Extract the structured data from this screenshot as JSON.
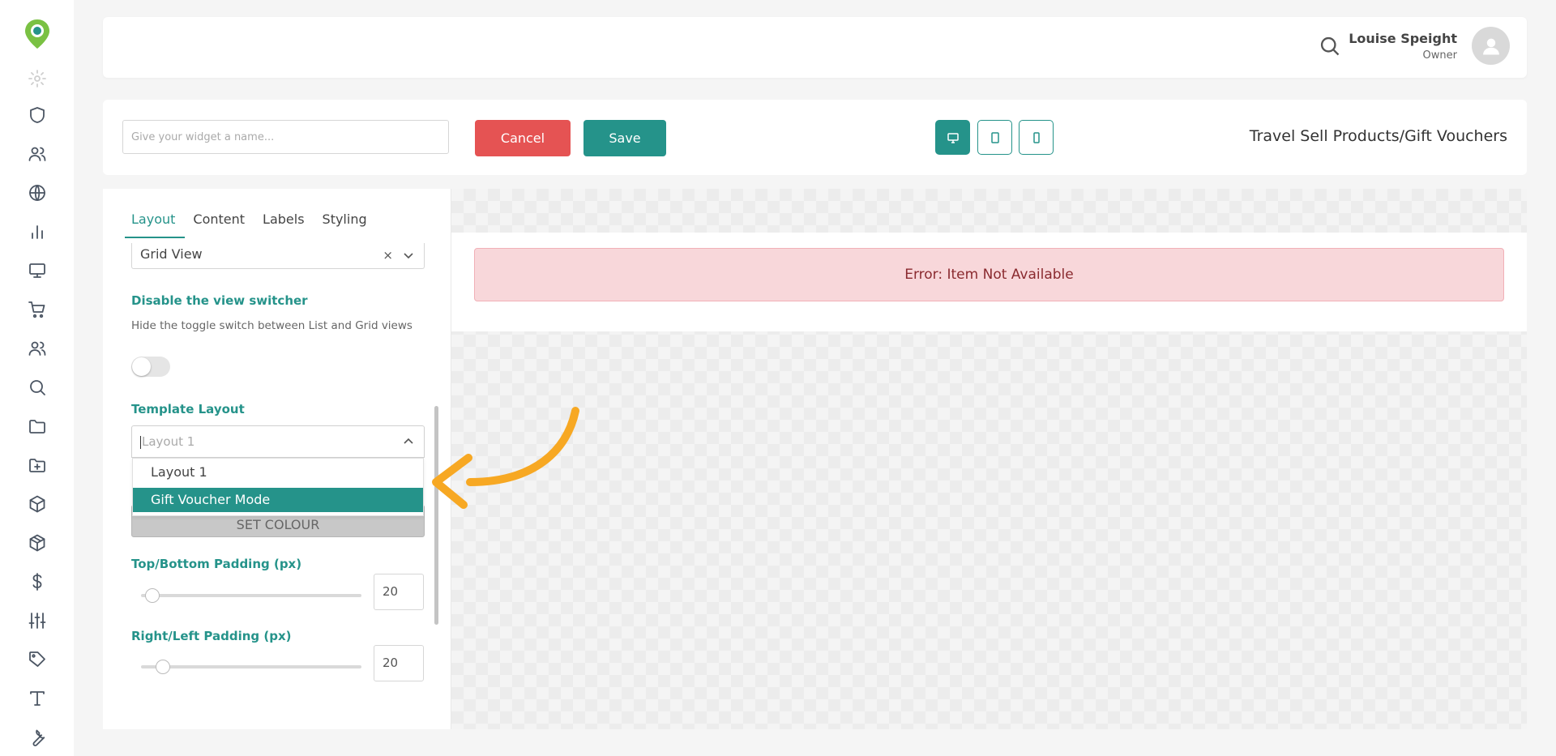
{
  "header": {
    "user_name": "Louise Speight",
    "user_role": "Owner"
  },
  "toolbar": {
    "name_placeholder": "Give your widget a name...",
    "name_value": "",
    "cancel_label": "Cancel",
    "save_label": "Save",
    "title": "Travel Sell Products/Gift Vouchers",
    "devices": [
      "desktop-icon",
      "tablet-icon",
      "mobile-icon"
    ],
    "active_device": "desktop"
  },
  "panel": {
    "tabs": [
      {
        "label": "Layout",
        "active": true
      },
      {
        "label": "Content",
        "active": false
      },
      {
        "label": "Labels",
        "active": false
      },
      {
        "label": "Styling",
        "active": false
      }
    ],
    "view_select_value": "Grid View",
    "view_select_clear": "×",
    "disable_switcher_label": "Disable the view switcher",
    "disable_switcher_help": "Hide the toggle switch between List and Grid views",
    "disable_switcher_on": false,
    "template_layout_label": "Template Layout",
    "template_layout_placeholder": "Layout 1",
    "template_options": [
      "Layout 1",
      "Gift Voucher Mode"
    ],
    "template_highlighted": "Gift Voucher Mode",
    "set_colour_label": "SET COLOUR",
    "top_bottom_label": "Top/Bottom Padding (px)",
    "top_bottom_value": "20",
    "top_bottom_fraction": 0.02,
    "right_left_label": "Right/Left Padding (px)",
    "right_left_value": "20",
    "right_left_fraction": 0.07
  },
  "preview": {
    "error_text": "Error: Item Not Available"
  },
  "colors": {
    "accent": "#25938a",
    "danger": "#e55353",
    "error_bg": "#f8d7da",
    "annotation_arrow": "#f7a823"
  }
}
